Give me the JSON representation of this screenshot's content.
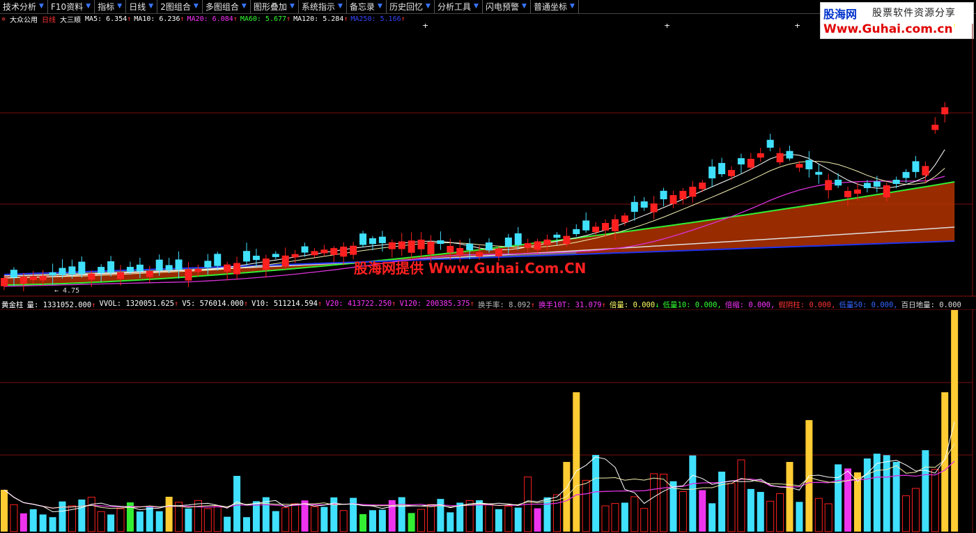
{
  "toolbar": [
    {
      "label": "技术分析",
      "arrow": true
    },
    {
      "label": "F10资料",
      "arrow": true
    },
    {
      "label": "指标",
      "arrow": true
    },
    {
      "label": "日线",
      "arrow": true
    },
    {
      "label": "2图组合",
      "arrow": true
    },
    {
      "label": "多图组合",
      "arrow": true
    },
    {
      "label": "图形叠加",
      "arrow": true
    },
    {
      "label": "系统指示",
      "arrow": true
    },
    {
      "label": "备忘录",
      "arrow": true
    },
    {
      "label": "历史回忆",
      "arrow": true
    },
    {
      "label": "分析工具",
      "arrow": true
    },
    {
      "label": "闪电预警",
      "arrow": true
    },
    {
      "label": "普通坐标",
      "arrow": true
    }
  ],
  "stock": {
    "name": "大众公用",
    "period": "日线",
    "indicator": "大三顺"
  },
  "ma_legend": [
    {
      "label": "MA5: 6.354",
      "color": "#ffffff"
    },
    {
      "label": "MA10: 6.236",
      "color": "#ffffff"
    },
    {
      "label": "MA20: 6.084",
      "color": "#ff33ff"
    },
    {
      "label": "MA60: 5.677",
      "color": "#33ff33"
    },
    {
      "label": "MA120: 5.284",
      "color": "#ffffff"
    },
    {
      "label": "MA250: 5.166",
      "color": "#3344ff"
    }
  ],
  "low_label": "4.75",
  "vol_legend_title": "黄金柱",
  "vol_legend": [
    {
      "label": "量: 1331052.000",
      "color": "#ffffff",
      "arrow": "↑"
    },
    {
      "label": "VVOL: 1320051.625",
      "color": "#ffffff",
      "arrow": "↑"
    },
    {
      "label": "V5: 576014.000",
      "color": "#ffffff",
      "arrow": "↑"
    },
    {
      "label": "V10: 511214.594",
      "color": "#ffffff",
      "arrow": "↑"
    },
    {
      "label": "V20: 413722.250",
      "color": "#ff33ff",
      "arrow": "↑"
    },
    {
      "label": "V120: 200385.375",
      "color": "#ff33ff",
      "arrow": "↑"
    },
    {
      "label": "换手率: 8.092",
      "color": "#bbbbbb",
      "arrow": "↑"
    },
    {
      "label": "换手10T: 31.079",
      "color": "#ff33ff",
      "arrow": "↑"
    },
    {
      "label": "倍量: 0.000",
      "color": "#ffff66",
      "arrow": "↓"
    },
    {
      "label": "低量10: 0.000,",
      "color": "#33ff33",
      "arrow": ""
    },
    {
      "label": "倍缩: 0.000,",
      "color": "#ff33ff",
      "arrow": ""
    },
    {
      "label": "假阴柱: 0.000,",
      "color": "#ff3333",
      "arrow": ""
    },
    {
      "label": "低量50: 0.000,",
      "color": "#3366ff",
      "arrow": ""
    },
    {
      "label": "百日地量: 0.000",
      "color": "#dddddd",
      "arrow": ""
    }
  ],
  "logo": {
    "brand": "股海网",
    "slogan": "股票软件资源分享",
    "url": "Www.Guhai.com.cn"
  },
  "watermark": "股海网提供 Www.Guhai.Com.CN",
  "colors": {
    "up": "#ff2020",
    "down": "#40e0ff",
    "grid": "#7a1010",
    "ma_band": "#b33300"
  }
}
